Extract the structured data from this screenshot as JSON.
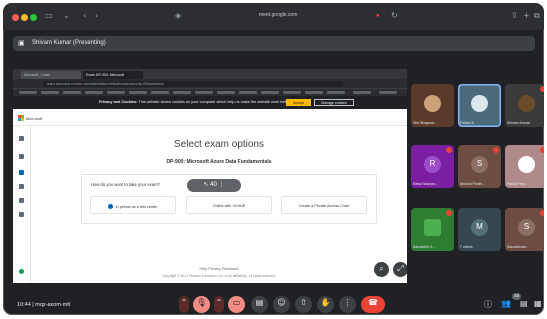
{
  "window": {
    "url": "meet.google.com",
    "recording_indicator": "●"
  },
  "meet_header": {
    "presenter_label": "Shivam Kumar (Presenting)"
  },
  "shared_screen": {
    "browser_tabs": [
      "Microsoft - Learn",
      "Exam DP-900: Microsoft"
    ],
    "address": "learn.microsoft.com/en-us/credentials/certifications/exams/dp-900/schedule",
    "cookie_banner": {
      "title": "Privacy and Cookies:",
      "message": "This website stores cookies on your computer which help us make the website work better for you.",
      "accept_label": "Accept",
      "manage_label": "Manage cookies"
    },
    "brand": "Microsoft",
    "page_title": "Select exam options",
    "exam_name": "DP-900: Microsoft Azure Data Fundamentals",
    "question": "How do you want to take your exam?",
    "control_pill": "↖ 40 ⋮",
    "options": [
      "In person at a test center",
      "Online with OnVUE",
      "Create a Private Access Code"
    ],
    "footer_links": "Help   Privacy   Feedback",
    "footer_copy": "Copyright © 2024 Pearson Education, Inc. or its affiliate(s). All rights reserved."
  },
  "participants": [
    {
      "name": "Shri Bhagwat...",
      "color": "#5a3a28"
    },
    {
      "name": "Pawan K",
      "color": "#4a6a7a"
    },
    {
      "name": "Shivam Kumar",
      "color": "#3a3a3a"
    },
    {
      "name": "Rahul Maurya...",
      "color": "#7b1fa2",
      "initial": "R"
    },
    {
      "name": "Shivani Panth...",
      "color": "#6d4c41",
      "initial": "S"
    },
    {
      "name": "Pallavi Pan...",
      "color": "#b08a8a"
    },
    {
      "name": "Saurabhiri K...",
      "color": "#2e7d32"
    },
    {
      "name": "7 others",
      "color": "#37474f",
      "initial": "M"
    },
    {
      "name": "Saurabhnan...",
      "color": "#6d4c41",
      "initial": "S"
    }
  ],
  "bottom_bar": {
    "time_and_code": "10:44  |  mqz-axom-mlt"
  },
  "participant_count": "16",
  "colors": {
    "danger": "#ea4335",
    "accent": "#8ab4f8",
    "ms_yellow": "#ffb900"
  }
}
